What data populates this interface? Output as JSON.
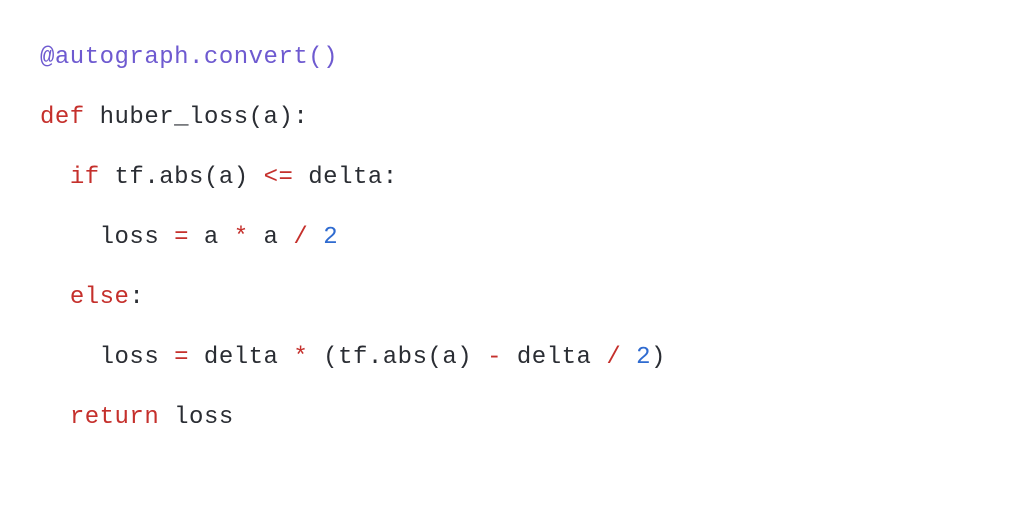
{
  "code": {
    "lines": [
      {
        "indent": 0,
        "tokens": [
          {
            "t": "@autograph.convert()",
            "c": "tok-decorator"
          }
        ]
      },
      {
        "indent": 0,
        "tokens": [
          {
            "t": "def",
            "c": "tok-keyword"
          },
          {
            "t": " ",
            "c": "tok-text"
          },
          {
            "t": "huber_loss",
            "c": "tok-funcname"
          },
          {
            "t": "(a):",
            "c": "tok-punct"
          }
        ]
      },
      {
        "indent": 1,
        "tokens": [
          {
            "t": "if",
            "c": "tok-keyword"
          },
          {
            "t": " tf.abs(a) ",
            "c": "tok-text"
          },
          {
            "t": "<=",
            "c": "tok-operator"
          },
          {
            "t": " delta:",
            "c": "tok-text"
          }
        ]
      },
      {
        "indent": 2,
        "tokens": [
          {
            "t": "loss ",
            "c": "tok-text"
          },
          {
            "t": "=",
            "c": "tok-operator"
          },
          {
            "t": " a ",
            "c": "tok-text"
          },
          {
            "t": "*",
            "c": "tok-operator"
          },
          {
            "t": " a ",
            "c": "tok-text"
          },
          {
            "t": "/",
            "c": "tok-operator"
          },
          {
            "t": " ",
            "c": "tok-text"
          },
          {
            "t": "2",
            "c": "tok-number"
          }
        ]
      },
      {
        "indent": 1,
        "tokens": [
          {
            "t": "else",
            "c": "tok-keyword"
          },
          {
            "t": ":",
            "c": "tok-punct"
          }
        ]
      },
      {
        "indent": 2,
        "tokens": [
          {
            "t": "loss ",
            "c": "tok-text"
          },
          {
            "t": "=",
            "c": "tok-operator"
          },
          {
            "t": " delta ",
            "c": "tok-text"
          },
          {
            "t": "*",
            "c": "tok-operator"
          },
          {
            "t": " (tf.abs(a) ",
            "c": "tok-text"
          },
          {
            "t": "-",
            "c": "tok-operator"
          },
          {
            "t": " delta ",
            "c": "tok-text"
          },
          {
            "t": "/",
            "c": "tok-operator"
          },
          {
            "t": " ",
            "c": "tok-text"
          },
          {
            "t": "2",
            "c": "tok-number"
          },
          {
            "t": ")",
            "c": "tok-punct"
          }
        ]
      },
      {
        "indent": 1,
        "tokens": [
          {
            "t": "return",
            "c": "tok-keyword"
          },
          {
            "t": " loss",
            "c": "tok-text"
          }
        ]
      }
    ],
    "indent_unit": "  "
  }
}
